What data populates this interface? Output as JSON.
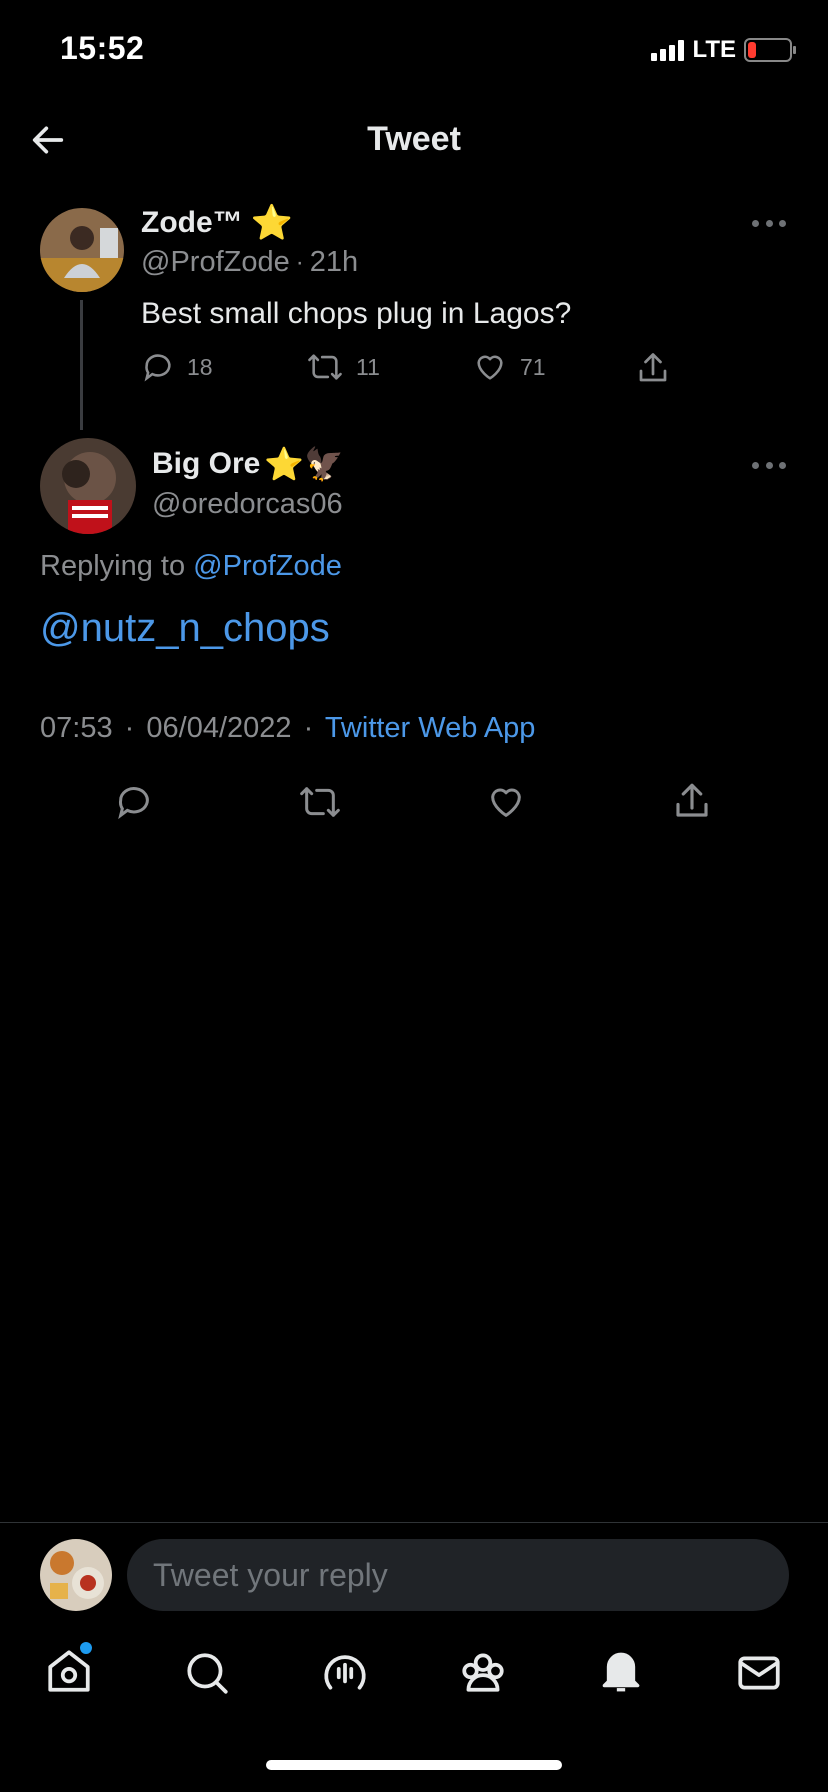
{
  "status_bar": {
    "time": "15:52",
    "network": "LTE",
    "battery_level": 0.15
  },
  "header": {
    "title": "Tweet"
  },
  "parent_tweet": {
    "name": "Zode™",
    "name_emoji": "⭐",
    "handle": "@ProfZode",
    "separator": "·",
    "age": "21h",
    "text": "Best small chops plug in Lagos?",
    "stats": {
      "replies": "18",
      "retweets": "11",
      "likes": "71"
    }
  },
  "main_tweet": {
    "name": "Big Ore",
    "name_emoji": "⭐🦅",
    "handle": "@oredorcas06",
    "replying_to_prefix": "Replying to",
    "replying_to_handle": "@ProfZode",
    "text": "@nutz_n_chops",
    "time": "07:53",
    "separator": "·",
    "date": "06/04/2022",
    "source": "Twitter Web App"
  },
  "reply_box": {
    "placeholder": "Tweet your reply"
  },
  "icons": {
    "back": "arrow-left-icon",
    "reply": "speech-bubble-icon",
    "retweet": "retweet-icon",
    "like": "heart-icon",
    "share": "share-icon",
    "more": "more-dots-icon",
    "tabs": [
      "home-icon",
      "search-icon",
      "spaces-icon",
      "communities-icon",
      "notifications-icon",
      "messages-icon"
    ]
  },
  "colors": {
    "background": "#000000",
    "link": "#4c98e8",
    "secondary_text": "#8b8d90",
    "notification_dot": "#1d9bf0"
  }
}
